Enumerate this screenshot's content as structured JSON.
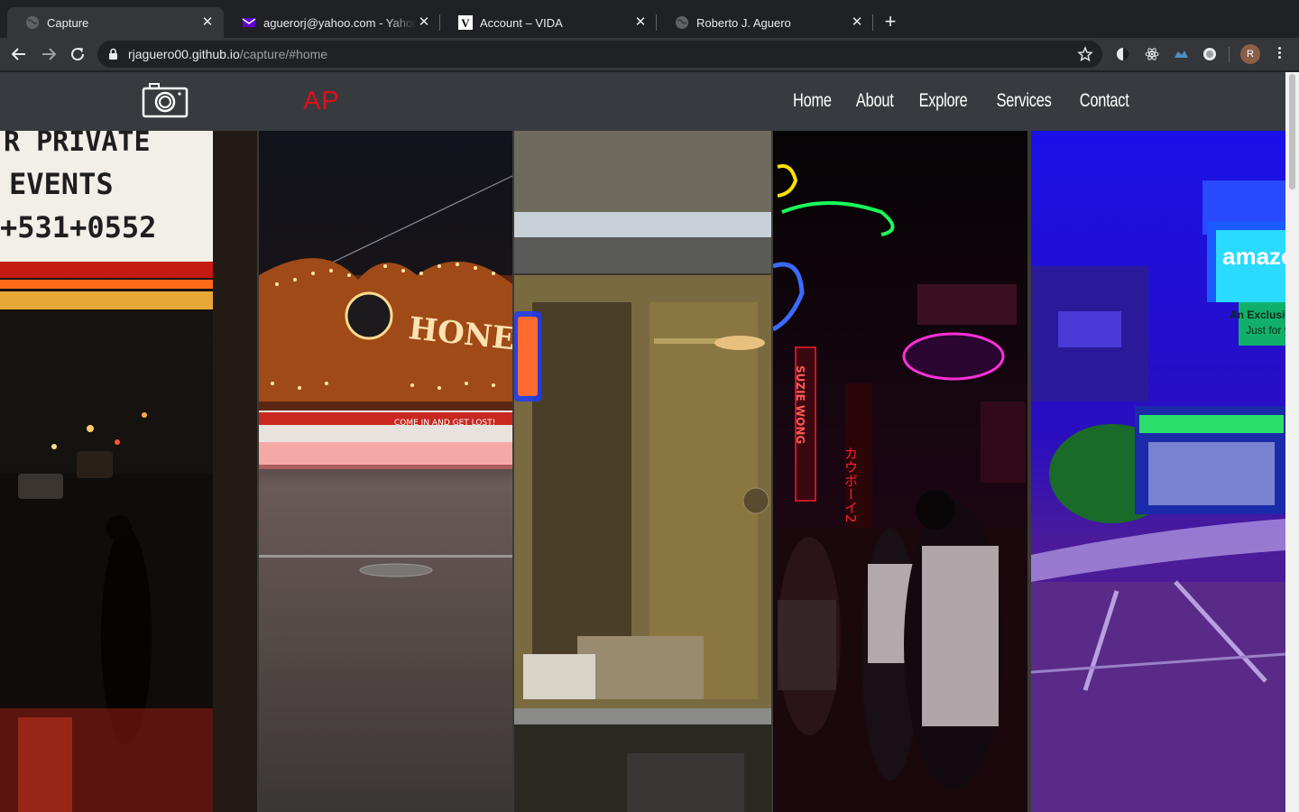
{
  "browser": {
    "tabs": [
      {
        "title": "Capture",
        "active": true,
        "icon": "globe-icon"
      },
      {
        "title": "aguerorj@yahoo.com - Yahoo Mail",
        "active": false,
        "icon": "yahoo-mail-icon"
      },
      {
        "title": "Account – VIDA",
        "active": false,
        "icon": "vida-icon"
      },
      {
        "title": "Roberto J. Aguero",
        "active": false,
        "icon": "globe-icon"
      }
    ],
    "url_host": "rjaguero00.github.io",
    "url_path": "/capture/#home",
    "profile_initial": "R"
  },
  "site": {
    "brand": "CAPTURE",
    "nav": [
      "Home",
      "About",
      "Explore",
      "Services",
      "Contact"
    ]
  },
  "gallery": {
    "panels": [
      {
        "name": "marquee-street",
        "sign_lines": [
          "R PRIVATE",
          "EVENTS",
          "+531+0552"
        ]
      },
      {
        "name": "honest-eds",
        "sign_lines": [
          "HONEST ED'S",
          "COME IN AND GET LOST!"
        ]
      },
      {
        "name": "restaurant-window",
        "sign_lines": []
      },
      {
        "name": "neon-alley",
        "sign_lines": [
          "SUZIE WONG",
          "カウボーイ2"
        ]
      },
      {
        "name": "amazon-square",
        "sign_lines": [
          "amazon",
          "An Exclusive V",
          "Just for yo"
        ]
      }
    ]
  },
  "colors": {
    "chrome_dark": "#202124",
    "chrome_toolbar": "#35363a",
    "site_nav": "#373b3f",
    "brand_red": "#e00f16"
  }
}
